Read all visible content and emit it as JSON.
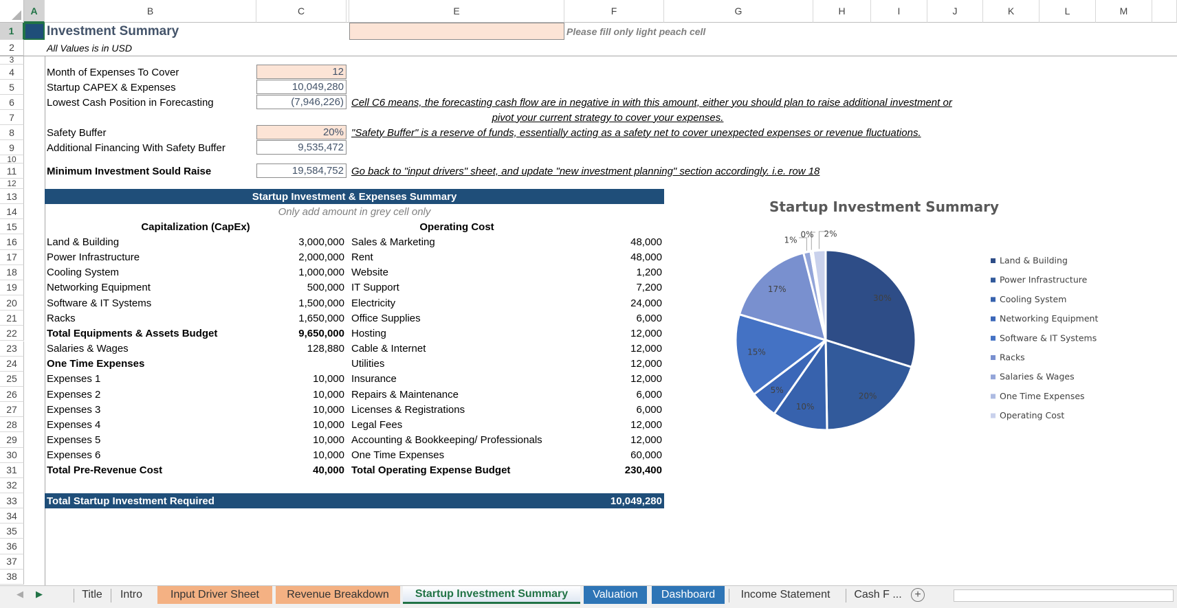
{
  "columns": [
    "A",
    "B",
    "C",
    "",
    "E",
    "F",
    "G",
    "H",
    "I",
    "J",
    "K",
    "L",
    "M"
  ],
  "selected_column": "A",
  "selected_row": 1,
  "rows": [
    1,
    2,
    3,
    4,
    5,
    6,
    7,
    8,
    9,
    10,
    11,
    12,
    13,
    14,
    15,
    16,
    17,
    18,
    19,
    20,
    21,
    22,
    23,
    24,
    25,
    26,
    27,
    28,
    29,
    30,
    31,
    32,
    33,
    34,
    35,
    36,
    37,
    38
  ],
  "header": {
    "title": "Investment Summary",
    "subtitle": "All Values is in USD",
    "fill_note": "Please fill only light peach cell"
  },
  "inputs": [
    {
      "label": "Month of Expenses To Cover",
      "value": "12",
      "editable": true
    },
    {
      "label": "Startup CAPEX & Expenses",
      "value": "10,049,280",
      "editable": false
    },
    {
      "label": "Lowest Cash Position in Forecasting",
      "value": "(7,946,226)",
      "editable": false
    },
    {
      "label": "Safety Buffer",
      "value": "20%",
      "editable": true
    },
    {
      "label": "Additional Financing With Safety Buffer",
      "value": "9,535,472",
      "editable": false
    },
    {
      "label": "Minimum Investment Sould Raise",
      "value": "19,584,752",
      "editable": false
    }
  ],
  "notes": {
    "cash_line1": "Cell C6 means, the forecasting cash flow are in negative in with this amount, either you should plan to raise additional investment or",
    "cash_line2": "pivot your current strategy to cover your expenses.",
    "safety": "\"Safety Buffer\" is a reserve of funds, essentially acting as a safety net to cover unexpected expenses or revenue fluctuations.",
    "go_back": "Go back to \"input drivers\" sheet, and update \"new investment planning\" section accordingly. i.e. row 18"
  },
  "summary_table": {
    "title": "Startup Investment & Expenses Summary",
    "note": "Only add amount in grey cell only",
    "capex_header": "Capitalization (CapEx)",
    "opex_header": "Operating Cost",
    "capex": [
      {
        "label": "Land & Building",
        "value": "3,000,000",
        "bold": false
      },
      {
        "label": "Power Infrastructure",
        "value": "2,000,000",
        "bold": false
      },
      {
        "label": "Cooling System",
        "value": "1,000,000",
        "bold": false
      },
      {
        "label": "Networking Equipment",
        "value": "500,000",
        "bold": false
      },
      {
        "label": "Software & IT Systems",
        "value": "1,500,000",
        "bold": false
      },
      {
        "label": "Racks",
        "value": "1,650,000",
        "bold": false
      },
      {
        "label": "Total Equipments & Assets Budget",
        "value": "9,650,000",
        "bold": true
      },
      {
        "label": "Salaries & Wages",
        "value": "128,880",
        "bold": false
      },
      {
        "label": "One Time Expenses",
        "value": "",
        "bold": true
      },
      {
        "label": "Expenses 1",
        "value": "10,000",
        "bold": false
      },
      {
        "label": "Expenses 2",
        "value": "10,000",
        "bold": false
      },
      {
        "label": "Expenses 3",
        "value": "10,000",
        "bold": false
      },
      {
        "label": "Expenses 4",
        "value": "10,000",
        "bold": false
      },
      {
        "label": "Expenses 5",
        "value": "10,000",
        "bold": false
      },
      {
        "label": "Expenses 6",
        "value": "10,000",
        "bold": false
      },
      {
        "label": "Total Pre-Revenue Cost",
        "value": "40,000",
        "bold": true
      }
    ],
    "opex": [
      {
        "label": "Sales & Marketing",
        "value": "48,000",
        "bold": false
      },
      {
        "label": "Rent",
        "value": "48,000",
        "bold": false
      },
      {
        "label": "Website",
        "value": "1,200",
        "bold": false
      },
      {
        "label": "IT Support",
        "value": "7,200",
        "bold": false
      },
      {
        "label": "Electricity",
        "value": "24,000",
        "bold": false
      },
      {
        "label": "Office Supplies",
        "value": "6,000",
        "bold": false
      },
      {
        "label": "Hosting",
        "value": "12,000",
        "bold": false
      },
      {
        "label": "Cable & Internet",
        "value": "12,000",
        "bold": false
      },
      {
        "label": "Utilities",
        "value": "12,000",
        "bold": false
      },
      {
        "label": "Insurance",
        "value": "12,000",
        "bold": false
      },
      {
        "label": "Repairs & Maintenance",
        "value": "6,000",
        "bold": false
      },
      {
        "label": "Licenses & Registrations",
        "value": "6,000",
        "bold": false
      },
      {
        "label": "Legal Fees",
        "value": "12,000",
        "bold": false
      },
      {
        "label": "Accounting & Bookkeeping/ Professionals",
        "value": "12,000",
        "bold": false
      },
      {
        "label": "One Time Expenses",
        "value": "60,000",
        "bold": false
      },
      {
        "label": "Total Operating Expense Budget",
        "value": "230,400",
        "bold": true
      }
    ],
    "total_label": "Total Startup Investment Required",
    "total_value": "10,049,280"
  },
  "chart_data": {
    "type": "pie",
    "title": "Startup Investment Summary",
    "categories": [
      "Land & Building",
      "Power Infrastructure",
      "Cooling System",
      "Networking Equipment",
      "Software & IT Systems",
      "Racks",
      "Salaries & Wages",
      "One Time Expenses",
      "Operating Cost"
    ],
    "values": [
      3000000,
      2000000,
      1000000,
      500000,
      1500000,
      1650000,
      128880,
      40000,
      230400
    ],
    "data_labels": [
      "30%",
      "20%",
      "10%",
      "5%",
      "15%",
      "17%",
      "1%",
      "0%",
      "2%"
    ],
    "colors": [
      "#2e4d87",
      "#325a9b",
      "#3762ad",
      "#3b67b8",
      "#4472c4",
      "#7990cf",
      "#93a5d9",
      "#adbbe2",
      "#c9d1ec"
    ],
    "legend_position": "right"
  },
  "sheet_tabs": [
    {
      "label": "Title",
      "kind": "plain"
    },
    {
      "label": "Intro",
      "kind": "plain"
    },
    {
      "label": "Input Driver Sheet",
      "kind": "peach"
    },
    {
      "label": "Revenue Breakdown",
      "kind": "peach"
    },
    {
      "label": "Startup Investment Summary",
      "kind": "active"
    },
    {
      "label": "Valuation",
      "kind": "blue"
    },
    {
      "label": "Dashboard",
      "kind": "blue"
    },
    {
      "label": "Income Statement",
      "kind": "plain"
    },
    {
      "label": "Cash F ...",
      "kind": "plain"
    }
  ],
  "tab_nav": {
    "add_sheet": "+"
  }
}
